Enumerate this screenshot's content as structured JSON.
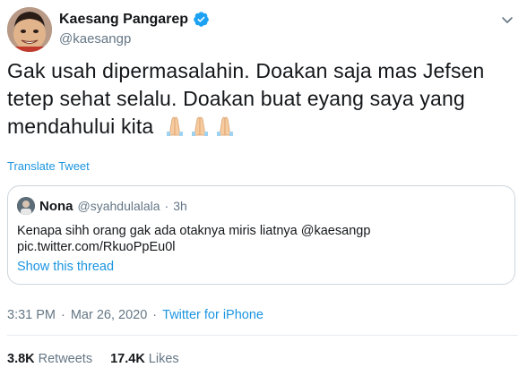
{
  "author": {
    "name": "Kaesang Pangarep",
    "handle": "@kaesangp",
    "verified_color": "#1da1f2"
  },
  "tweet": {
    "text": "Gak usah dipermasalahin. Doakan saja mas Jefsen tetep sehat selalu. Doakan buat eyang saya yang mendahului kita",
    "emoji": "🙏🏻🙏🏻🙏🏻",
    "translate_label": "Translate Tweet"
  },
  "quote": {
    "name": "Nona",
    "handle": "@syahdulalala",
    "separator": "·",
    "time": "3h",
    "text": "Kenapa sihh orang gak ada otaknya miris liatnya @kaesangp",
    "link": "pic.twitter.com/RkuoPpEu0l",
    "show_thread": "Show this thread"
  },
  "meta": {
    "time": "3:31 PM",
    "separator1": "·",
    "date": "Mar 26, 2020",
    "separator2": "·",
    "source": "Twitter for iPhone"
  },
  "stats": {
    "retweets_count": "3.8K",
    "retweets_label": "Retweets",
    "likes_count": "17.4K",
    "likes_label": "Likes"
  },
  "colors": {
    "link": "#1b95e0",
    "muted": "#657786",
    "border": "#ccd6dd"
  }
}
